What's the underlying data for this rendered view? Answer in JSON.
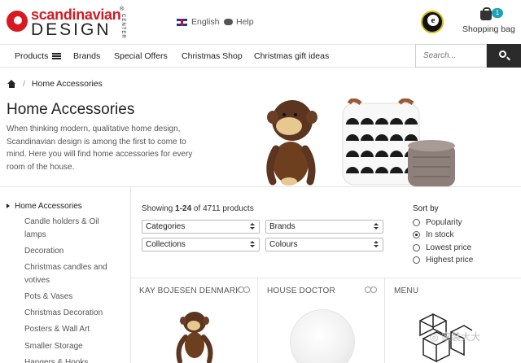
{
  "brand": {
    "top": "scandinavian",
    "bottom": "DESIGN",
    "side": "CENTER",
    "reg": "®"
  },
  "header": {
    "language": "English",
    "help": "Help",
    "bag_label": "Shopping bag",
    "bag_count": "1"
  },
  "nav": {
    "items": [
      "Products",
      "Brands",
      "Special Offers",
      "Christmas Shop",
      "Christmas gift ideas"
    ],
    "search_placeholder": "Search..."
  },
  "breadcrumb": {
    "current": "Home Accessories",
    "separator": "/"
  },
  "page": {
    "title": "Home Accessories",
    "intro": "When thinking modern, qualitative home design, Scandinavian design is among the first to come to mind. Here you will find home accessories for every room of the house."
  },
  "sidebar": {
    "heading": "Home Accessories",
    "items": [
      "Candle holders & Oil lamps",
      "Decoration",
      "Christmas candles and votives",
      "Pots & Vases",
      "Christmas Decoration",
      "Posters & Wall Art",
      "Smaller Storage",
      "Hangers & Hooks"
    ]
  },
  "results": {
    "prefix": "Showing ",
    "range": "1-24",
    "middle": " of ",
    "total": "4711",
    "suffix": " products"
  },
  "filters": {
    "categories": "Categories",
    "brands": "Brands",
    "collections": "Collections",
    "colours": "Colours"
  },
  "sort": {
    "title": "Sort by",
    "options": [
      "Popularity",
      "In stock",
      "Lowest price",
      "Highest price"
    ],
    "selected": "In stock"
  },
  "products": [
    {
      "brand": "KAY BOJESEN DENMARK"
    },
    {
      "brand": "HOUSE DOCTOR"
    },
    {
      "brand": "MENU"
    }
  ],
  "watermark": "◎ 家装大大",
  "colors": {
    "brand_red": "#d71920",
    "badge_teal": "#1aa3b8",
    "search_button": "#2b2b2b"
  },
  "icons": [
    "flag-uk-icon",
    "chat-icon",
    "trusted-shop-icon",
    "shopping-bag-icon",
    "hamburger-icon",
    "search-icon",
    "home-icon",
    "compare-icon"
  ]
}
